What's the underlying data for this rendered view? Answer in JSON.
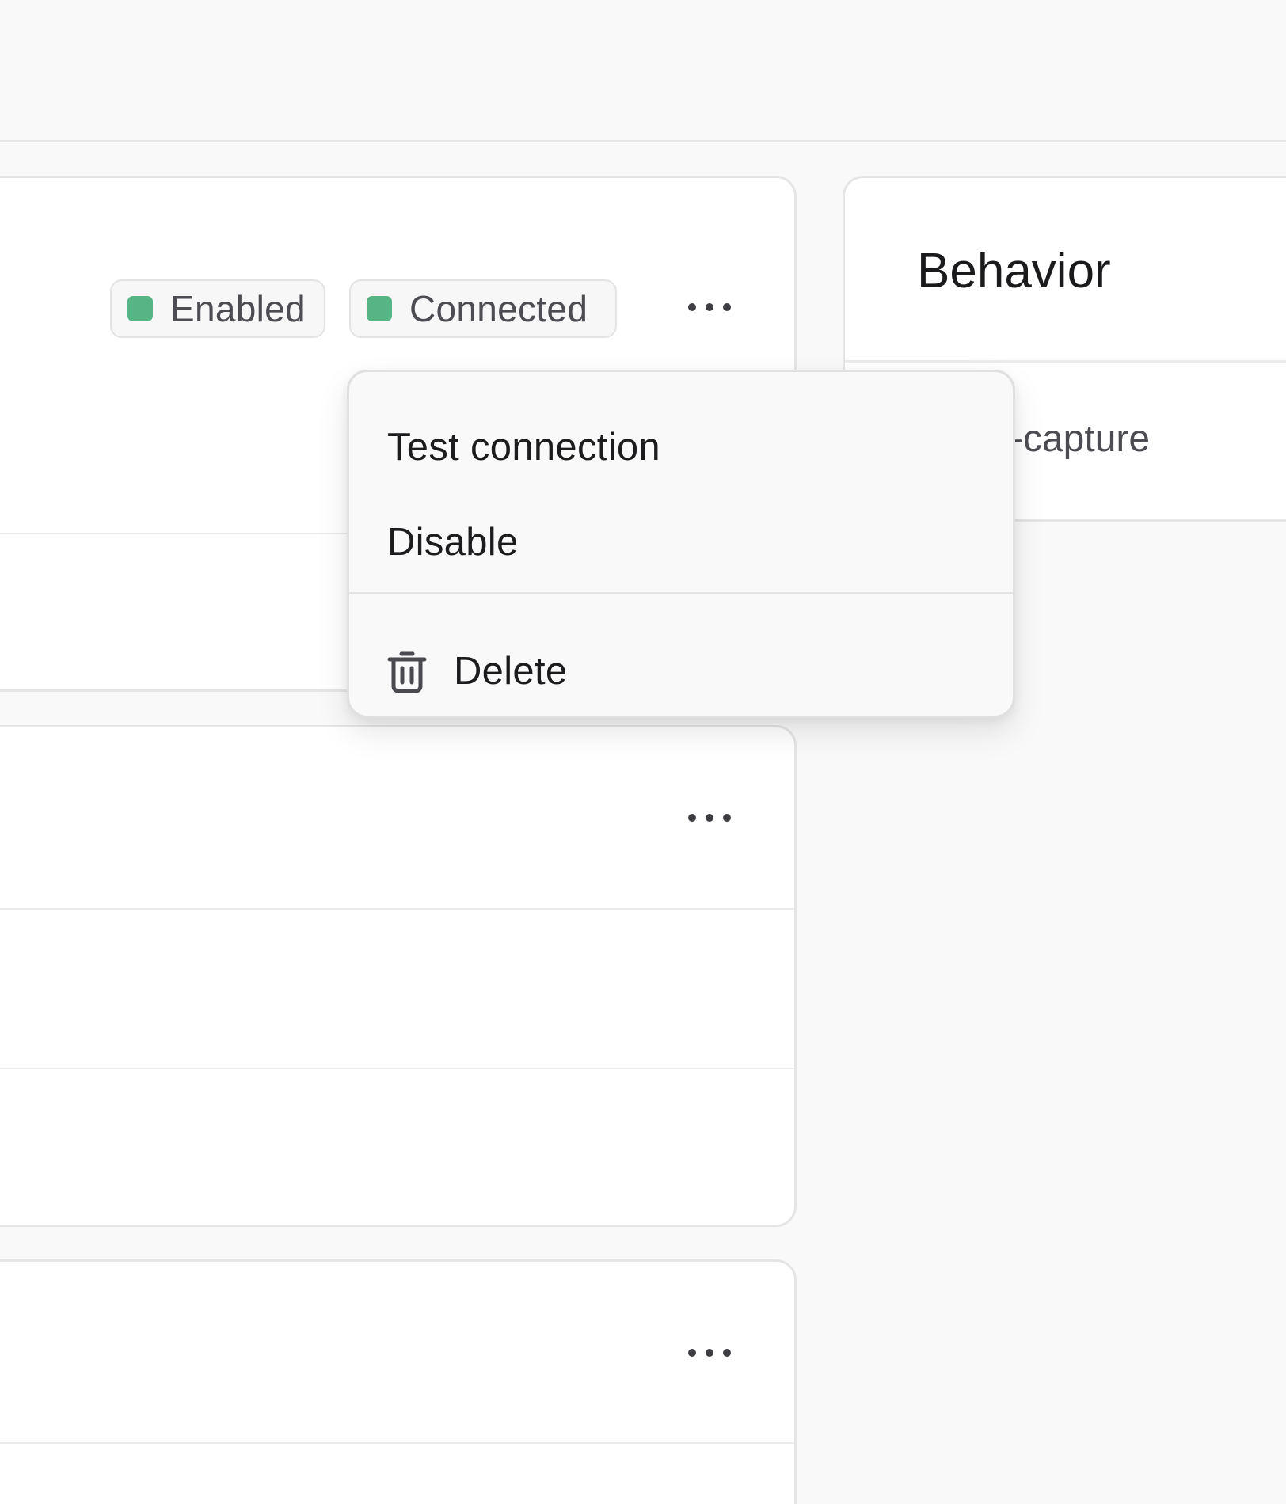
{
  "cards": [
    {
      "badges": [
        {
          "label": "Enabled",
          "status_color": "#57b485"
        },
        {
          "label": "Connected",
          "status_color": "#57b485"
        }
      ],
      "more_icon": "more-horizontal-icon"
    },
    {
      "more_icon": "more-horizontal-icon"
    },
    {
      "more_icon": "more-horizontal-icon"
    }
  ],
  "behavior": {
    "title": "Behavior",
    "value_fragment": "-capture"
  },
  "context_menu": {
    "items": [
      {
        "label": "Test connection"
      },
      {
        "label": "Disable"
      },
      {
        "label": "Delete",
        "icon": "trash-icon"
      }
    ]
  }
}
